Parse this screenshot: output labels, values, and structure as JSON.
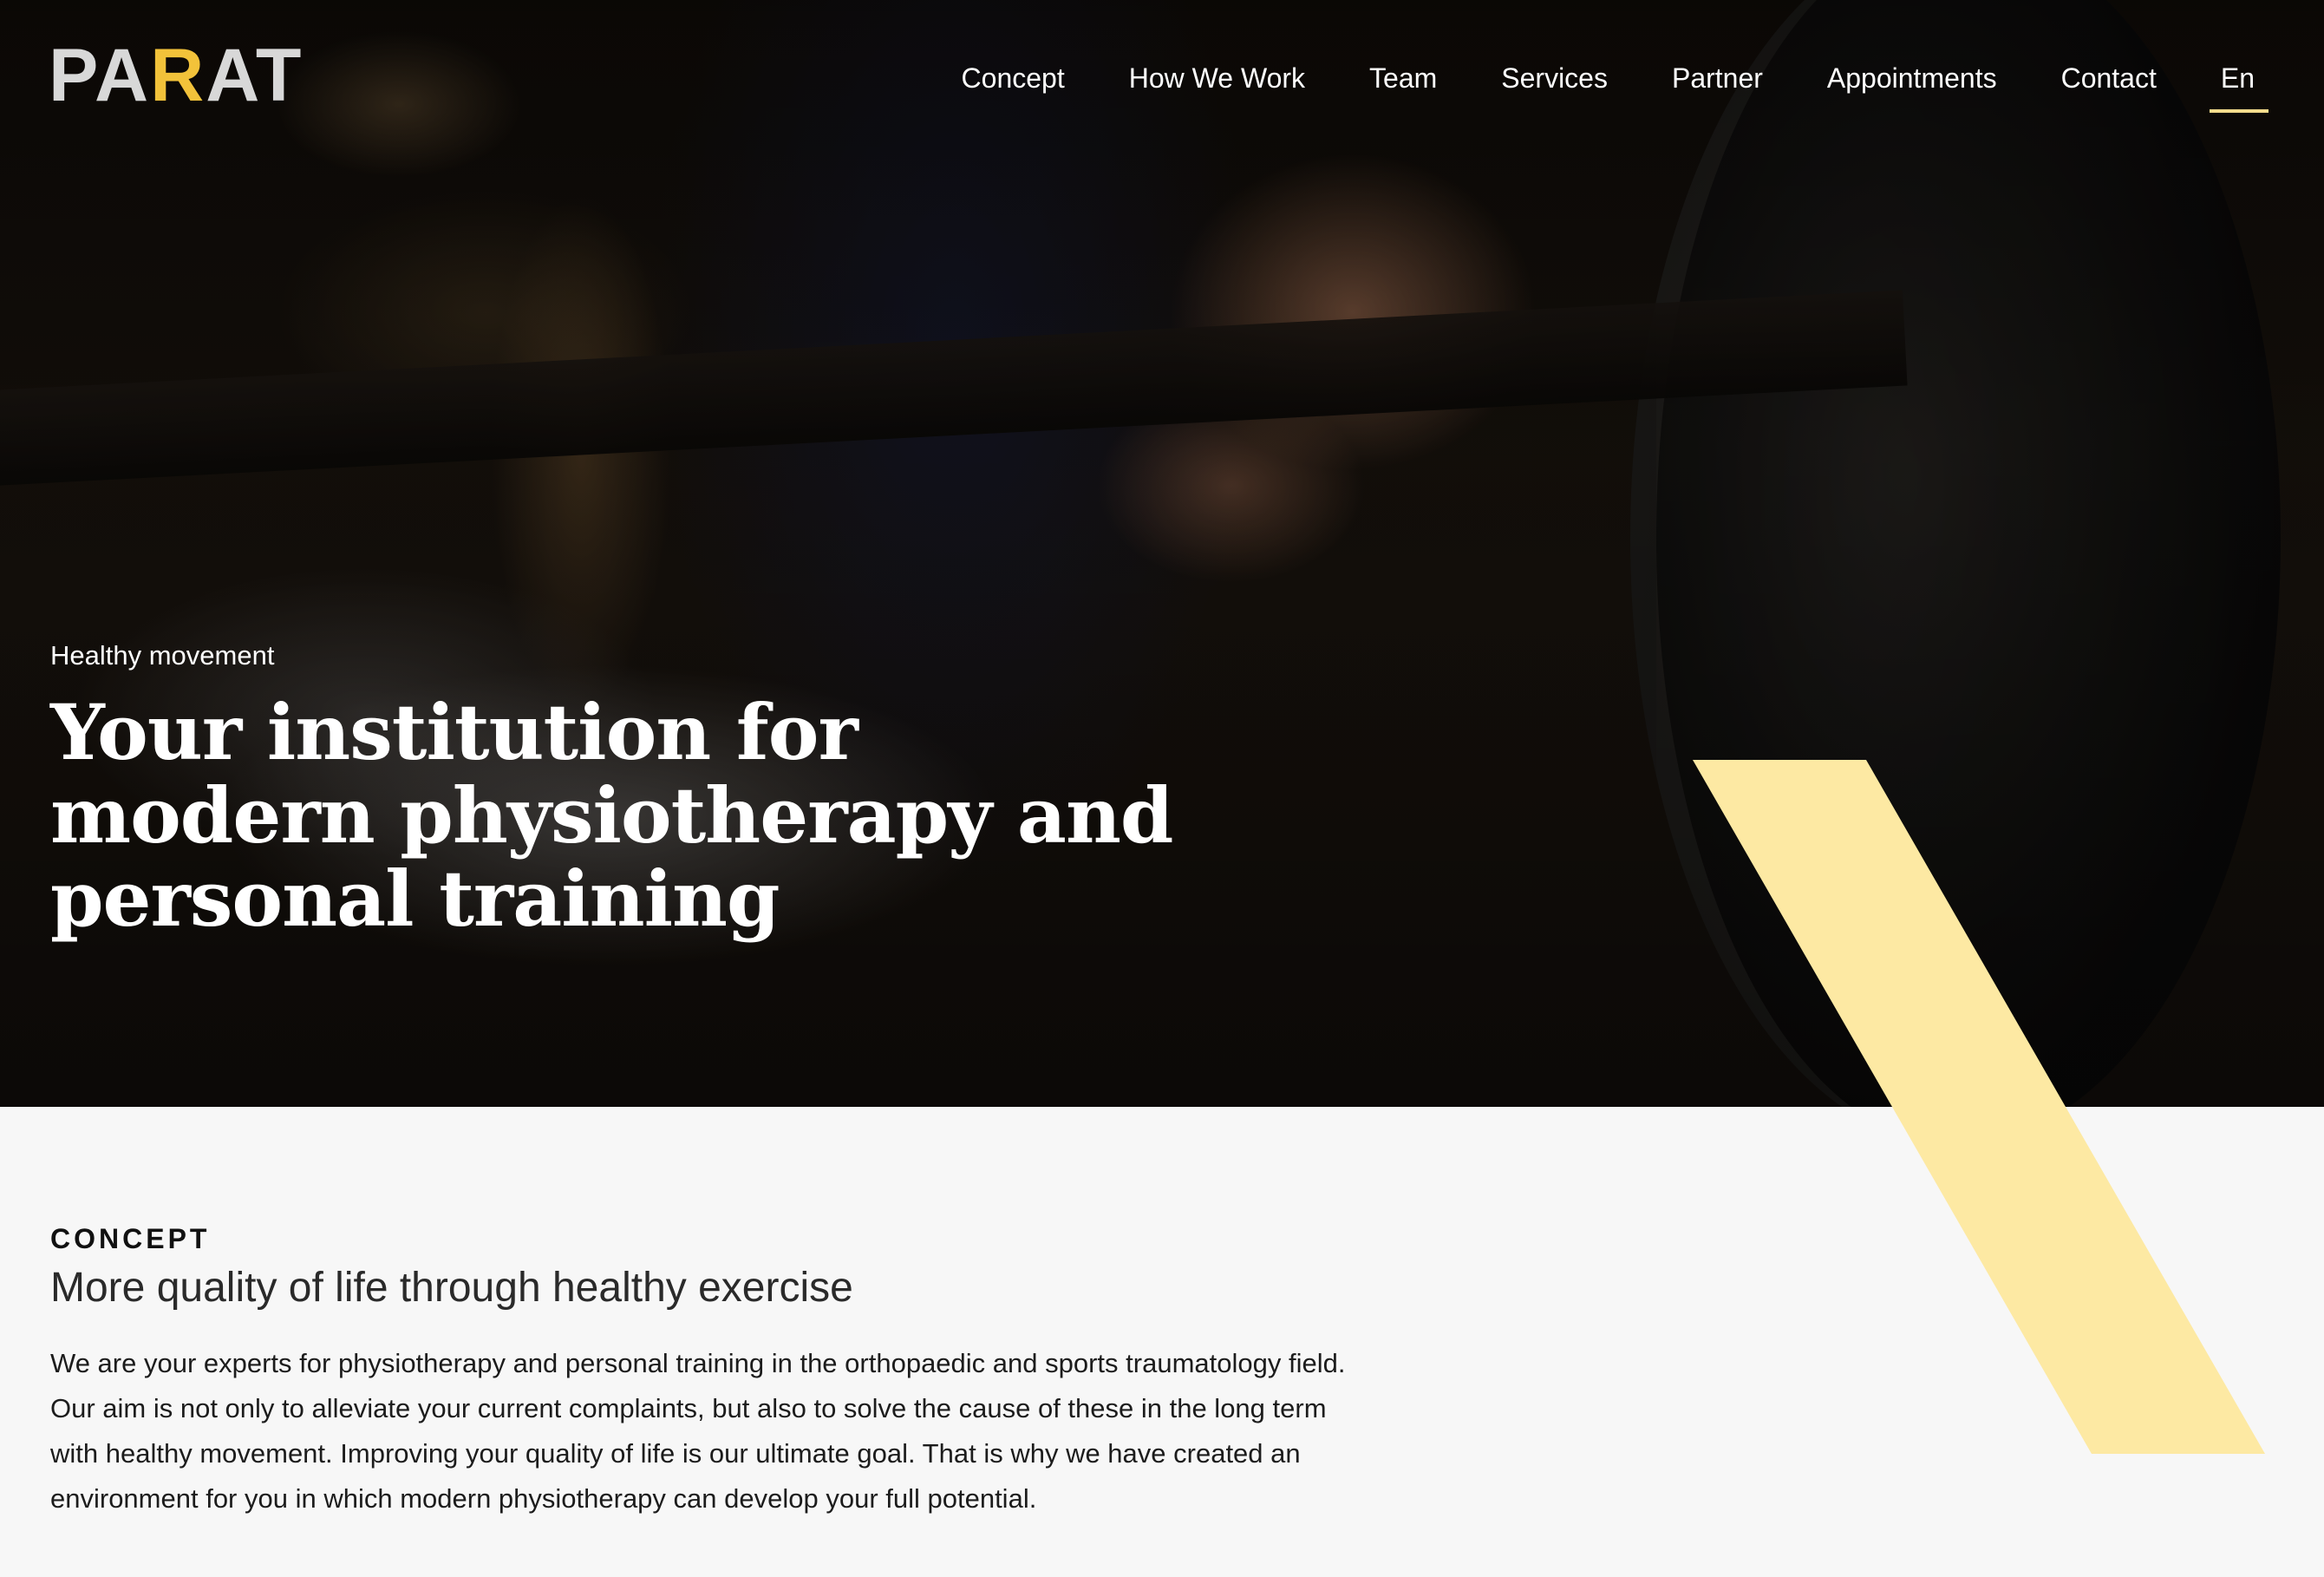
{
  "brand": {
    "logo_prefix": "PA",
    "logo_highlight": "R",
    "logo_suffix": "AT",
    "accent_color": "#f2c23a",
    "shape_color": "#fde9a3"
  },
  "nav": {
    "items": [
      {
        "label": "Concept"
      },
      {
        "label": "How We Work"
      },
      {
        "label": "Team"
      },
      {
        "label": "Services"
      },
      {
        "label": "Partner"
      },
      {
        "label": "Appointments"
      },
      {
        "label": "Contact"
      },
      {
        "label": "En"
      }
    ],
    "active_item": "En"
  },
  "hero": {
    "eyebrow": "Healthy movement",
    "title_line1": "Your institution for",
    "title_line2": "modern physiotherapy and",
    "title_line3": "personal training"
  },
  "concept": {
    "label": "CONCEPT",
    "subtitle": "More quality of life through healthy exercise",
    "body_line1": "We are your experts for physiotherapy and personal training in the orthopaedic and sports traumatology field.",
    "body_line2": "Our aim is not only to alleviate your current complaints, but also to solve the cause of these in the long term",
    "body_line3": "with healthy movement. Improving your quality of life is our ultimate goal. That is why we have created an",
    "body_line4": "environment for you in which modern physiotherapy can develop your full potential."
  }
}
